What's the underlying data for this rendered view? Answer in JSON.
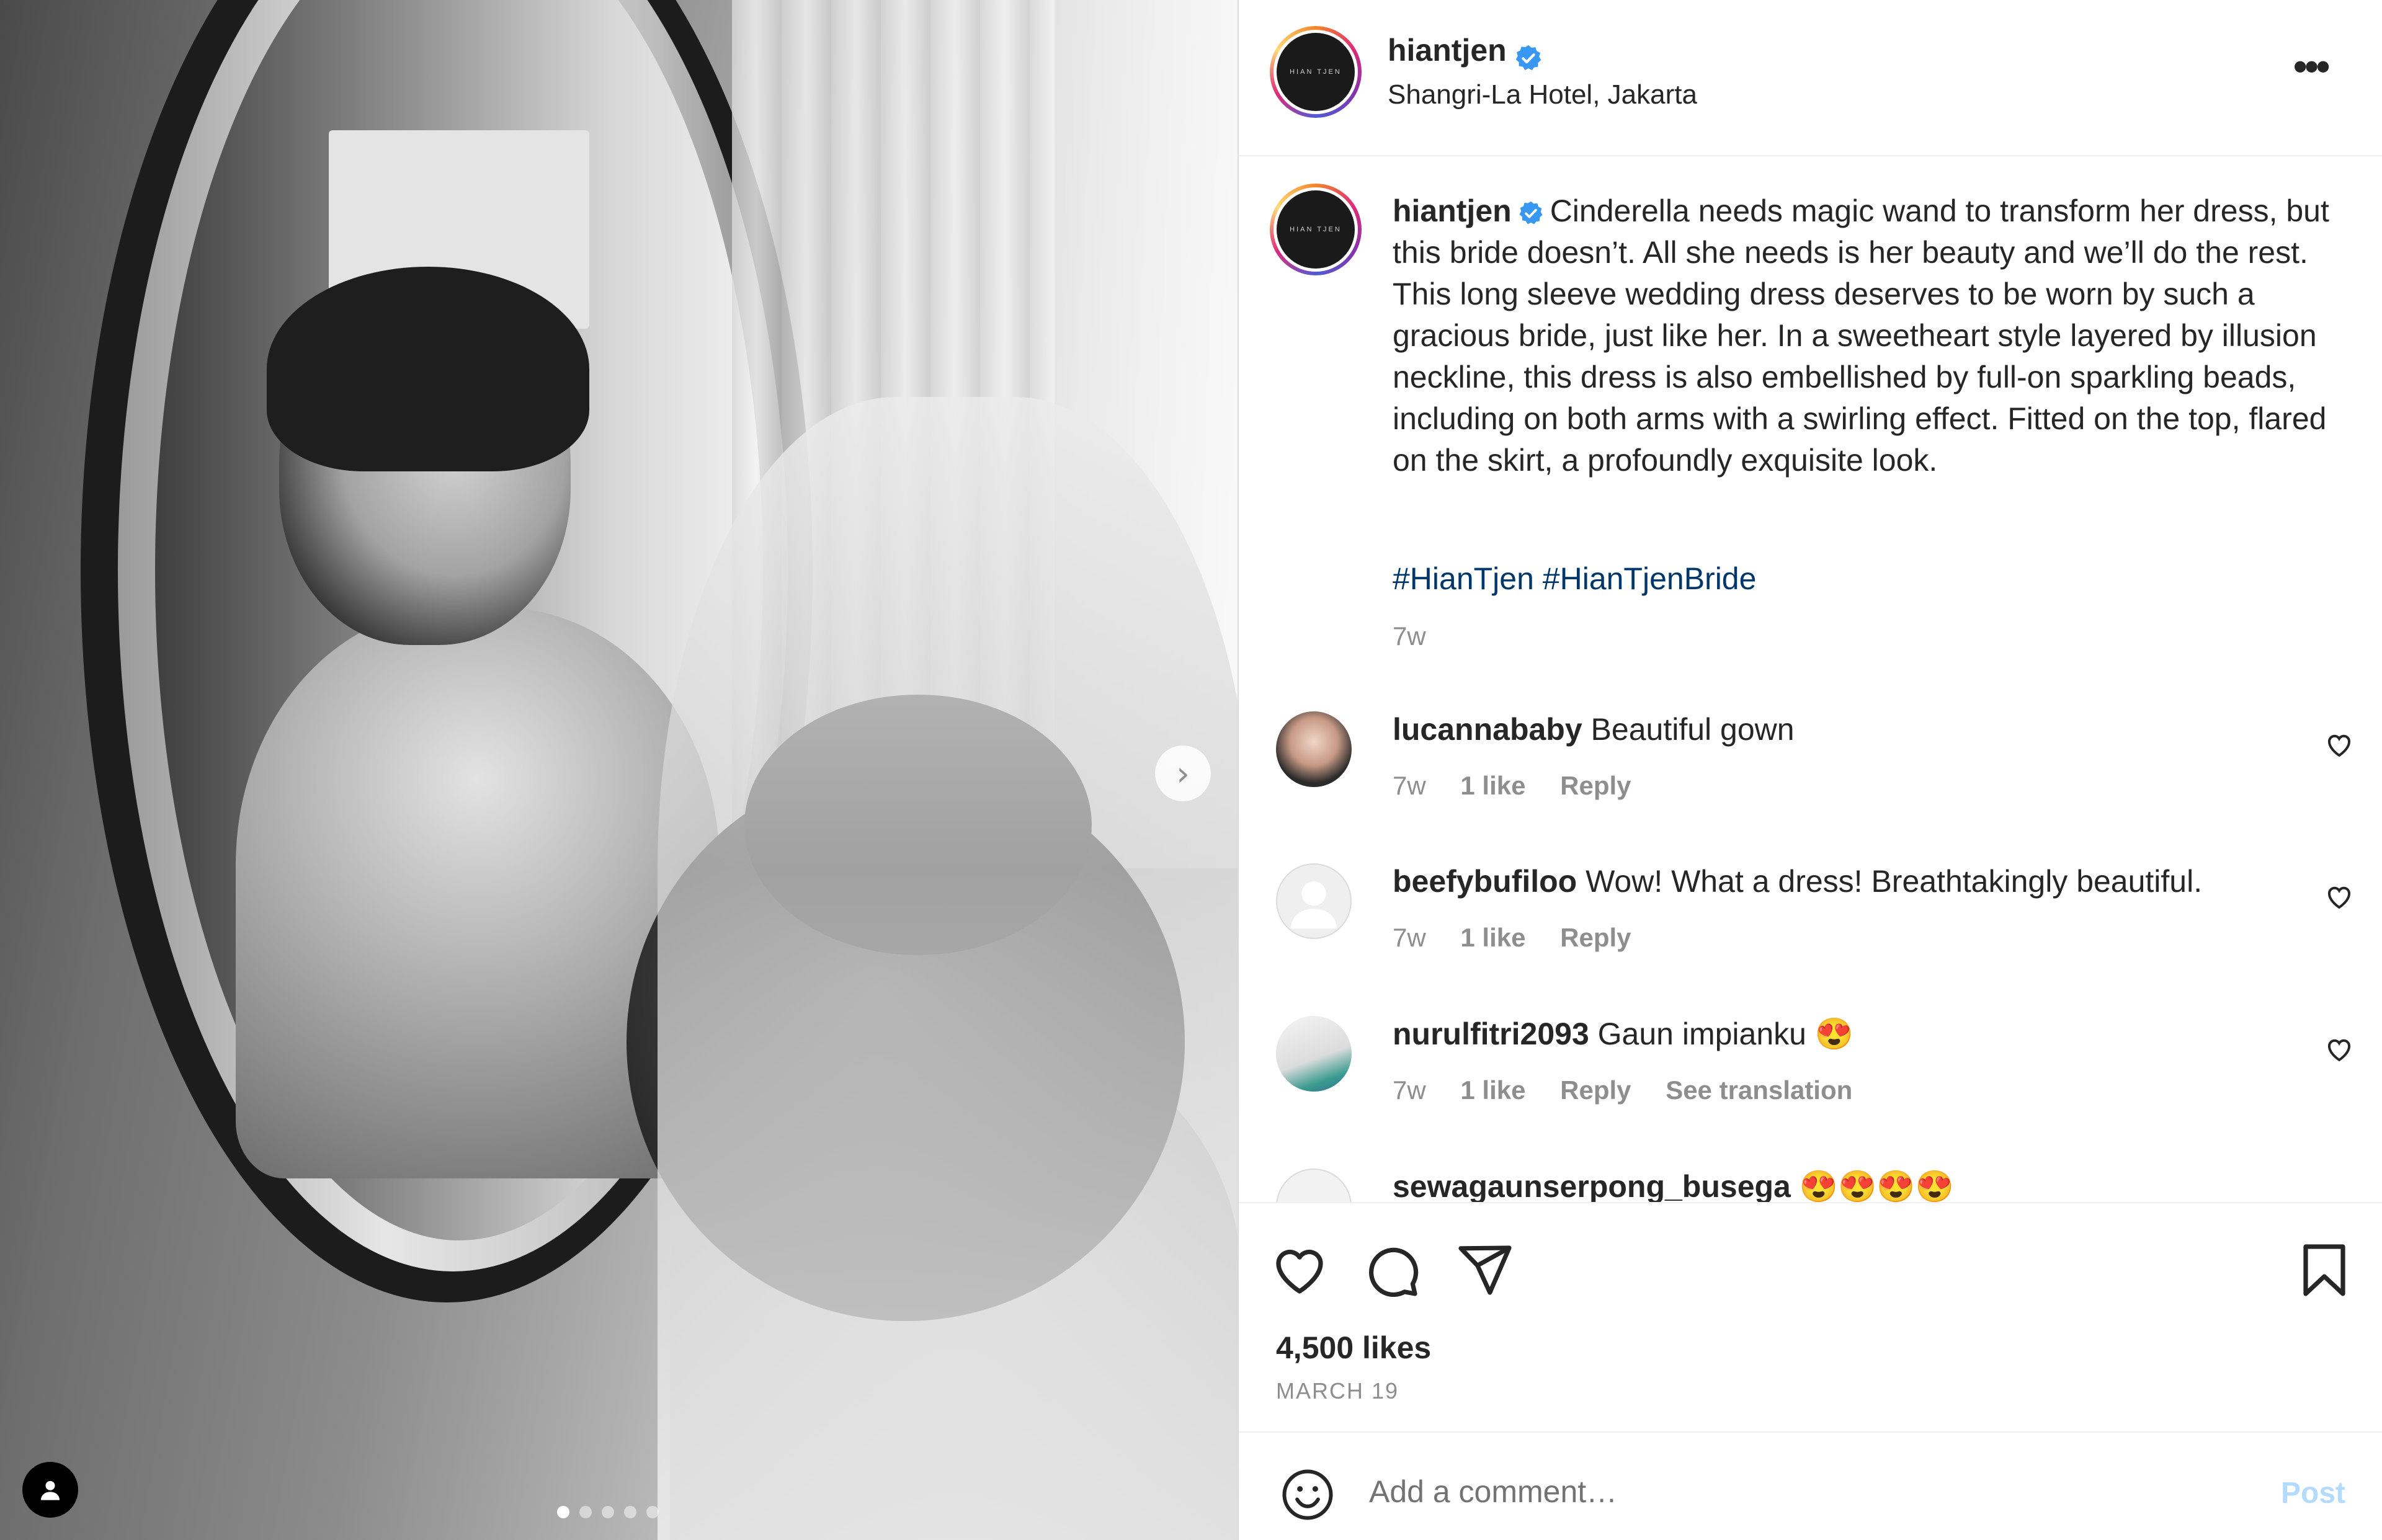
{
  "post": {
    "username": "hiantjen",
    "location": "Shangri-La Hotel, Jakarta",
    "avatar_logo_text": "HIAN TJEN",
    "caption": "Cinderella needs magic wand to transform her dress, but this bride doesn’t. All she needs is her beauty and we’ll do the rest. This long sleeve wedding dress deserves to be worn by such a gracious bride, just like her. In a sweetheart style layered by illusion neckline, this dress is also embellished by full-on sparkling beads, including on both arms with a swirling effect. Fitted on the top, flared on the skirt, a profoundly exquisite look.",
    "hashtags": "#HianTjen #HianTjenBride",
    "age": "7w",
    "likes": "4,500 likes",
    "date": "MARCH 19",
    "carousel": {
      "total": 5,
      "current": 1
    }
  },
  "comments": [
    {
      "username": "lucannababy",
      "text": "Beautiful gown",
      "age": "7w",
      "likes": "1 like",
      "reply": "Reply"
    },
    {
      "username": "beefybufiloo",
      "text": "Wow! What a dress! Breathtakingly beautiful.",
      "age": "7w",
      "likes": "1 like",
      "reply": "Reply"
    },
    {
      "username": "nurulfitri2093",
      "text": "Gaun impianku 😍",
      "age": "7w",
      "likes": "1 like",
      "reply": "Reply",
      "translate": "See translation"
    },
    {
      "username": "sewagaunserpong_busega",
      "text": "😍😍😍😍"
    }
  ],
  "add_comment": {
    "placeholder": "Add a comment…",
    "post_label": "Post"
  },
  "icons": {
    "more": "more-options-icon",
    "verified": "verified-badge-icon",
    "like": "heart-icon",
    "comment": "comment-bubble-icon",
    "share": "paper-plane-icon",
    "save": "bookmark-icon",
    "emoji": "smiley-icon",
    "next": "chevron-right-icon",
    "user_tag": "user-silhouette-icon"
  },
  "colors": {
    "verified": "#3897f0",
    "hashtag": "#00376b",
    "secondary": "#8e8e8e",
    "post_disabled": "#b3dbff"
  }
}
